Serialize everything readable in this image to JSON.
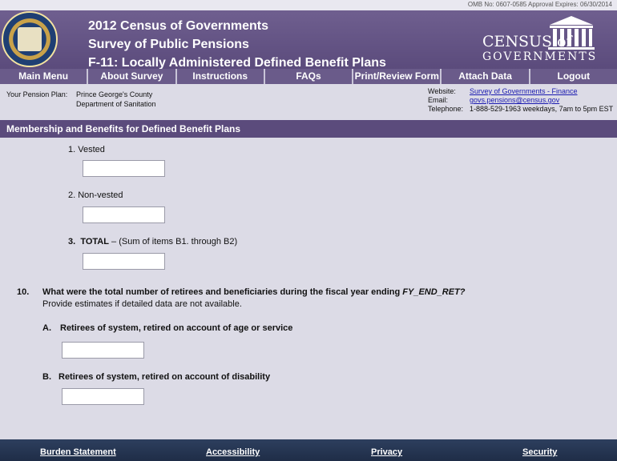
{
  "omb": "OMB No:  0607-0585  Approval Expires:  06/30/2014",
  "header": {
    "title_line1": "2012 Census of Governments",
    "title_line2": "Survey of Public Pensions",
    "title_line3": "F-11:  Locally Administered Defined Benefit Plans",
    "logo_line1": "CENSUS of",
    "logo_line2": "GOVERNMENTS"
  },
  "nav": {
    "items": [
      "Main Menu",
      "About Survey",
      "Instructions",
      "FAQs",
      "Print/Review Form",
      "Attach Data",
      "Logout"
    ]
  },
  "plan": {
    "label": "Your Pension Plan:",
    "name_line1": "Prince George's County",
    "name_line2": "Department of Sanitation"
  },
  "contact": {
    "website_label": "Website:",
    "website_value": "Survey of Governments - Finance",
    "email_label": "Email:",
    "email_value": "govs.pensions@census.gov",
    "telephone_label": "Telephone:",
    "telephone_value": "1-888-529-1963  weekdays, 7am to 5pm EST"
  },
  "section": {
    "title": "Membership and Benefits for Defined Benefit Plans"
  },
  "form": {
    "item1_label": "1.  Vested",
    "item1_value": "",
    "item2_label": "2.  Non-vested",
    "item2_value": "",
    "item3_number": "3.",
    "item3_bold": "TOTAL",
    "item3_rest": " – (Sum of items B1. through B2)",
    "item3_value": "",
    "q10_number": "10.",
    "q10_text": "What were the total number of retirees and beneficiaries during the fiscal year ending ",
    "q10_var": "FY_END_RET?",
    "q10_note": "Provide estimates if detailed data are not available.",
    "qA_letter": "A.",
    "qA_text": "Retirees of system, retired on account of age or service",
    "qA_value": "",
    "qB_letter": "B.",
    "qB_text": "Retirees of system, retired on account of disability",
    "qB_value": ""
  },
  "footer": {
    "burden": "Burden Statement",
    "accessibility": "Accessibility",
    "privacy": "Privacy",
    "security": "Security"
  }
}
